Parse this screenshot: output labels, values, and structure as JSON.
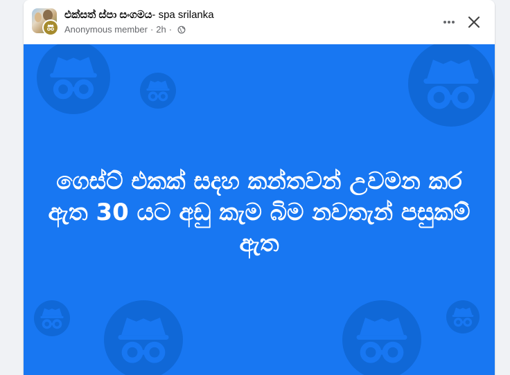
{
  "post": {
    "group_name": "එක්සත් ස්පා සංගමය",
    "group_name_suffix": "- spa srilanka",
    "author": "Anonymous member",
    "separator": "·",
    "time": "2h",
    "privacy_icon": "globe-icon",
    "more_icon": "more-horizontal-icon",
    "close_icon": "close-icon"
  },
  "image": {
    "text": "ගෙස්ට් එකක් සදහ කන්තවන් උවමන කර ඇත 30 යට අඩු කැම බිම නවතැන් පසුකම් ඇත",
    "background_color": "#1877f2",
    "pattern_icon": "incognito-icon"
  }
}
